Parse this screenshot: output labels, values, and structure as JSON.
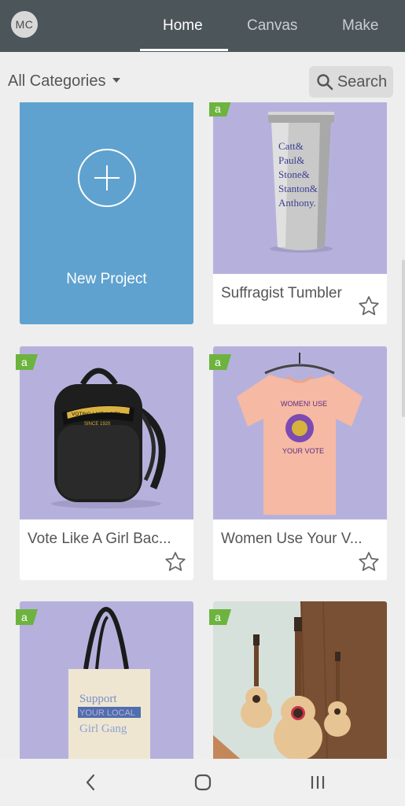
{
  "header": {
    "avatar_initials": "MC",
    "tabs": [
      {
        "label": "Home",
        "active": true
      },
      {
        "label": "Canvas",
        "active": false
      },
      {
        "label": "Make",
        "active": false
      }
    ]
  },
  "filters": {
    "category_label": "All Categories",
    "search_label": "Search"
  },
  "new_project": {
    "label": "New Project"
  },
  "projects": [
    {
      "title": "Suffragist Tumbler",
      "badge": "a",
      "favorited": false
    },
    {
      "title": "Vote Like A Girl Bac...",
      "badge": "a",
      "favorited": false
    },
    {
      "title": "Women Use Your V...",
      "badge": "a",
      "favorited": false
    },
    {
      "title": "",
      "badge": "a",
      "favorited": false
    },
    {
      "title": "",
      "badge": "a",
      "favorited": false
    }
  ],
  "product_text": {
    "tumbler_lines": [
      "Catt&",
      "Paul&",
      "Stone&",
      "Stanton&",
      "Anthony."
    ],
    "backpack_banner": "VOTING LIKE A GIRL",
    "backpack_since": "SINCE 1920",
    "shirt_top": "WOMEN! USE",
    "shirt_bottom": "YOUR VOTE",
    "tote_lines": [
      "Support",
      "YOUR LOCAL",
      "Girl Gang"
    ]
  },
  "colors": {
    "topbar": "#4c555a",
    "new_project": "#5fa2cf",
    "badge": "#6db33f",
    "product_bg": "#b6b1dc"
  },
  "nav": {
    "icons": [
      "back-icon",
      "home-icon",
      "recents-icon"
    ]
  }
}
